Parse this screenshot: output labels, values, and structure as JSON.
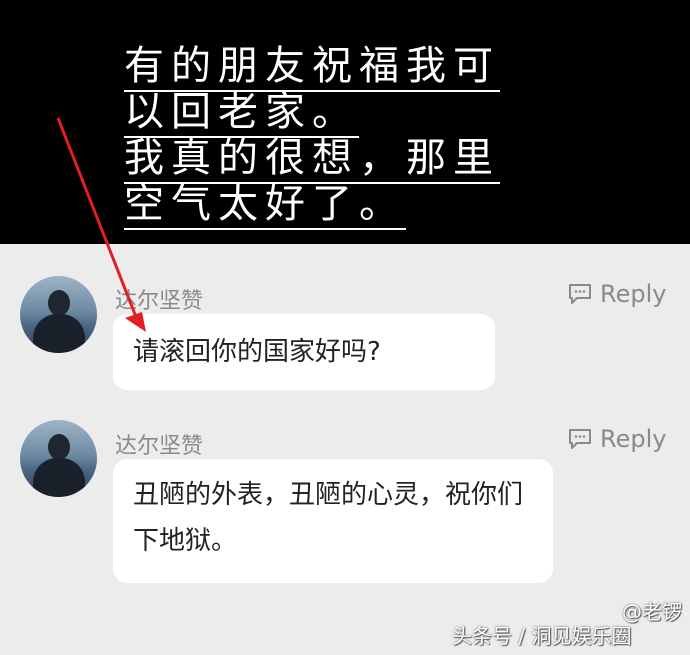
{
  "banner": {
    "lines": [
      "有的朋友祝福我可",
      "以回老家。",
      "我真的很想，那里",
      "空气太好了。"
    ]
  },
  "comments": [
    {
      "username": "达尔坚赞",
      "reply_label": "Reply",
      "text": "请滚回你的国家好吗?"
    },
    {
      "username": "达尔坚赞",
      "reply_label": "Reply",
      "text": "丑陋的外表，丑陋的心灵，祝你们下地狱。"
    }
  ],
  "watermark": {
    "author": "@老锣",
    "source": "头条号 / 洞见娱乐圈"
  },
  "colors": {
    "banner_bg": "#000000",
    "page_bg": "#ececec",
    "arrow": "#e02020",
    "meta_text": "#8a8a8a"
  },
  "icons": [
    "reply-icon",
    "avatar"
  ]
}
